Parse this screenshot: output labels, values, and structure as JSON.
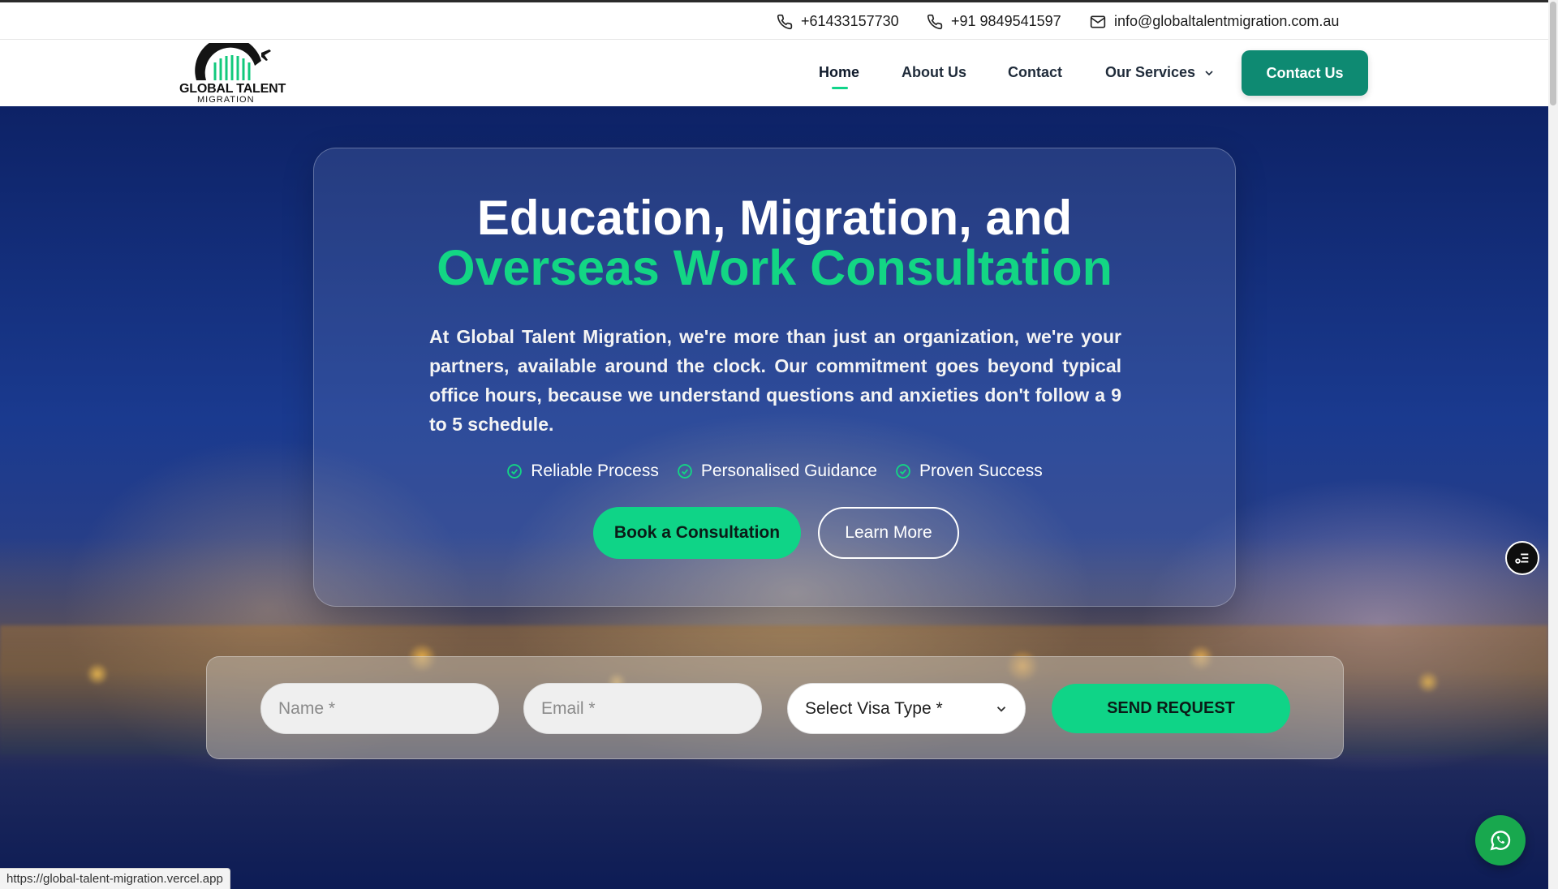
{
  "topbar": {
    "phone1": "+61433157730",
    "phone2": "+91 9849541597",
    "email": "info@globaltalentmigration.com.au"
  },
  "logo": {
    "brand": "GLOBAL TALENT",
    "sub": "MIGRATION"
  },
  "nav": {
    "items": [
      {
        "label": "Home",
        "active": true
      },
      {
        "label": "About Us"
      },
      {
        "label": "Contact"
      },
      {
        "label": "Our Services"
      }
    ],
    "cta": "Contact Us"
  },
  "hero": {
    "title_line1": "Education, Migration, and",
    "title_line2": "Overseas Work Consultation",
    "description": "At Global Talent Migration, we're more than just an organization, we're your partners, available around the clock. Our commitment goes beyond typical office hours, because we understand questions and anxieties don't follow a 9 to 5 schedule.",
    "features": [
      "Reliable Process",
      "Personalised Guidance",
      "Proven Success"
    ],
    "primary_button": "Book a Consultation",
    "secondary_button": "Learn More"
  },
  "request_form": {
    "name_placeholder": "Name *",
    "email_placeholder": "Email *",
    "visa_select": "Select Visa Type *",
    "submit": "SEND REQUEST"
  },
  "status_url": "https://global-talent-migration.vercel.app",
  "colors": {
    "accent": "#13d684",
    "cta": "#0e8a72",
    "whatsapp": "#18a84e"
  },
  "icons": [
    "phone-icon",
    "mail-icon",
    "chevron-down-icon",
    "check-circle-icon",
    "filter-menu-icon",
    "whatsapp-icon"
  ]
}
